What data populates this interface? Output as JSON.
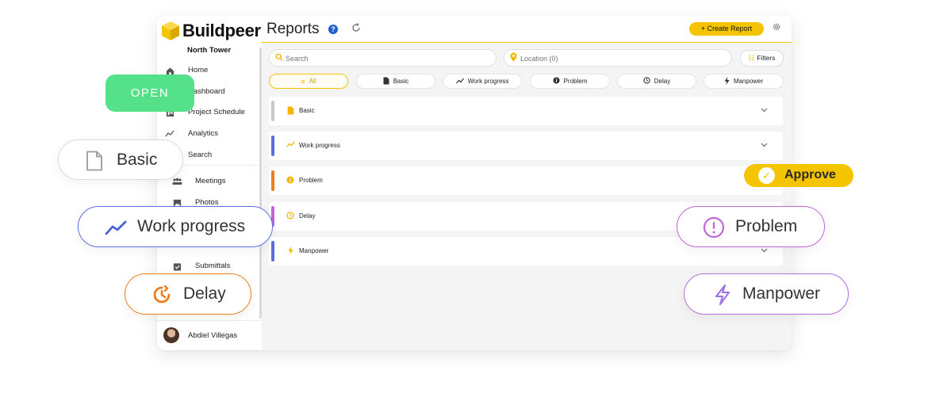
{
  "app": {
    "brand": "Buildpeer",
    "project": "North Tower",
    "title": "Reports"
  },
  "sidebar": {
    "items": [
      {
        "label": "Home",
        "icon": "home-icon"
      },
      {
        "label": "Dashboard",
        "icon": "dashboard-icon"
      },
      {
        "label": "Project Schedule",
        "icon": "schedule-icon"
      },
      {
        "label": "Analytics",
        "icon": "analytics-icon"
      },
      {
        "label": "Search",
        "icon": "search-icon"
      },
      {
        "label": "Meetings",
        "icon": "meetings-icon"
      },
      {
        "label": "Photos",
        "icon": "photos-icon"
      },
      {
        "label": "Submittals",
        "icon": "submittals-icon"
      }
    ],
    "user": "Abdiel Villegas"
  },
  "header": {
    "create_label": "+ Create Report"
  },
  "search": {
    "placeholder": "Search"
  },
  "location": {
    "placeholder": "Location (0)"
  },
  "filters_label": "Filters",
  "tabs": [
    {
      "label": "All",
      "active": true
    },
    {
      "label": "Basic"
    },
    {
      "label": "Work progress"
    },
    {
      "label": "Problem"
    },
    {
      "label": "Delay"
    },
    {
      "label": "Manpower"
    }
  ],
  "rows": [
    {
      "label": "Basic",
      "color": "#c8c8c8"
    },
    {
      "label": "Work progress",
      "color": "#5b6ee1"
    },
    {
      "label": "Problem",
      "color": "#f07d1a"
    },
    {
      "label": "Delay",
      "color": "#c167d6"
    },
    {
      "label": "Manpower",
      "color": "#5b6ee1"
    }
  ],
  "floating": {
    "open": "OPEN",
    "basic": "Basic",
    "work_progress": "Work progress",
    "delay": "Delay",
    "approve": "Approve",
    "problem": "Problem",
    "manpower": "Manpower"
  },
  "colors": {
    "brand_yellow": "#f4c400",
    "open_green": "#55e08a",
    "work_blue": "#5b6ee1",
    "delay_orange": "#f07d1a",
    "problem_purple": "#c167d6",
    "manpower_purple": "#9c6ee6"
  }
}
